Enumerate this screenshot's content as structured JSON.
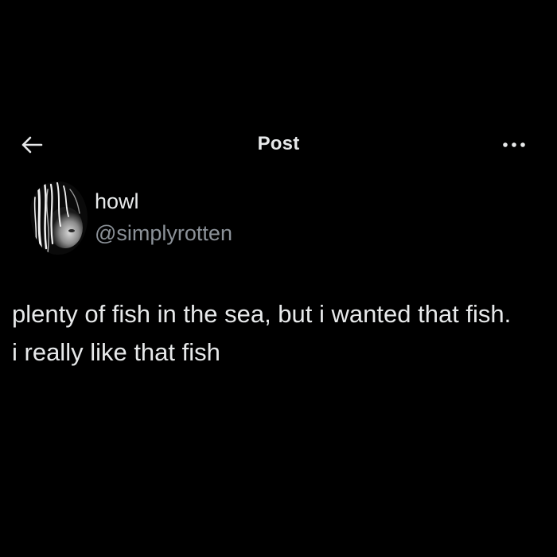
{
  "header": {
    "title": "Post",
    "back_icon": "arrow-left-icon",
    "more_icon": "more-horizontal-icon"
  },
  "post": {
    "author": {
      "display_name": "howl",
      "handle": "@simplyrotten",
      "avatar": "avatar-image"
    },
    "text": "plenty of fish in the sea, but i wanted that fish. i really like that fish"
  },
  "colors": {
    "background": "#000000",
    "text_primary": "#e7e9ea",
    "text_secondary": "#8b9198"
  }
}
